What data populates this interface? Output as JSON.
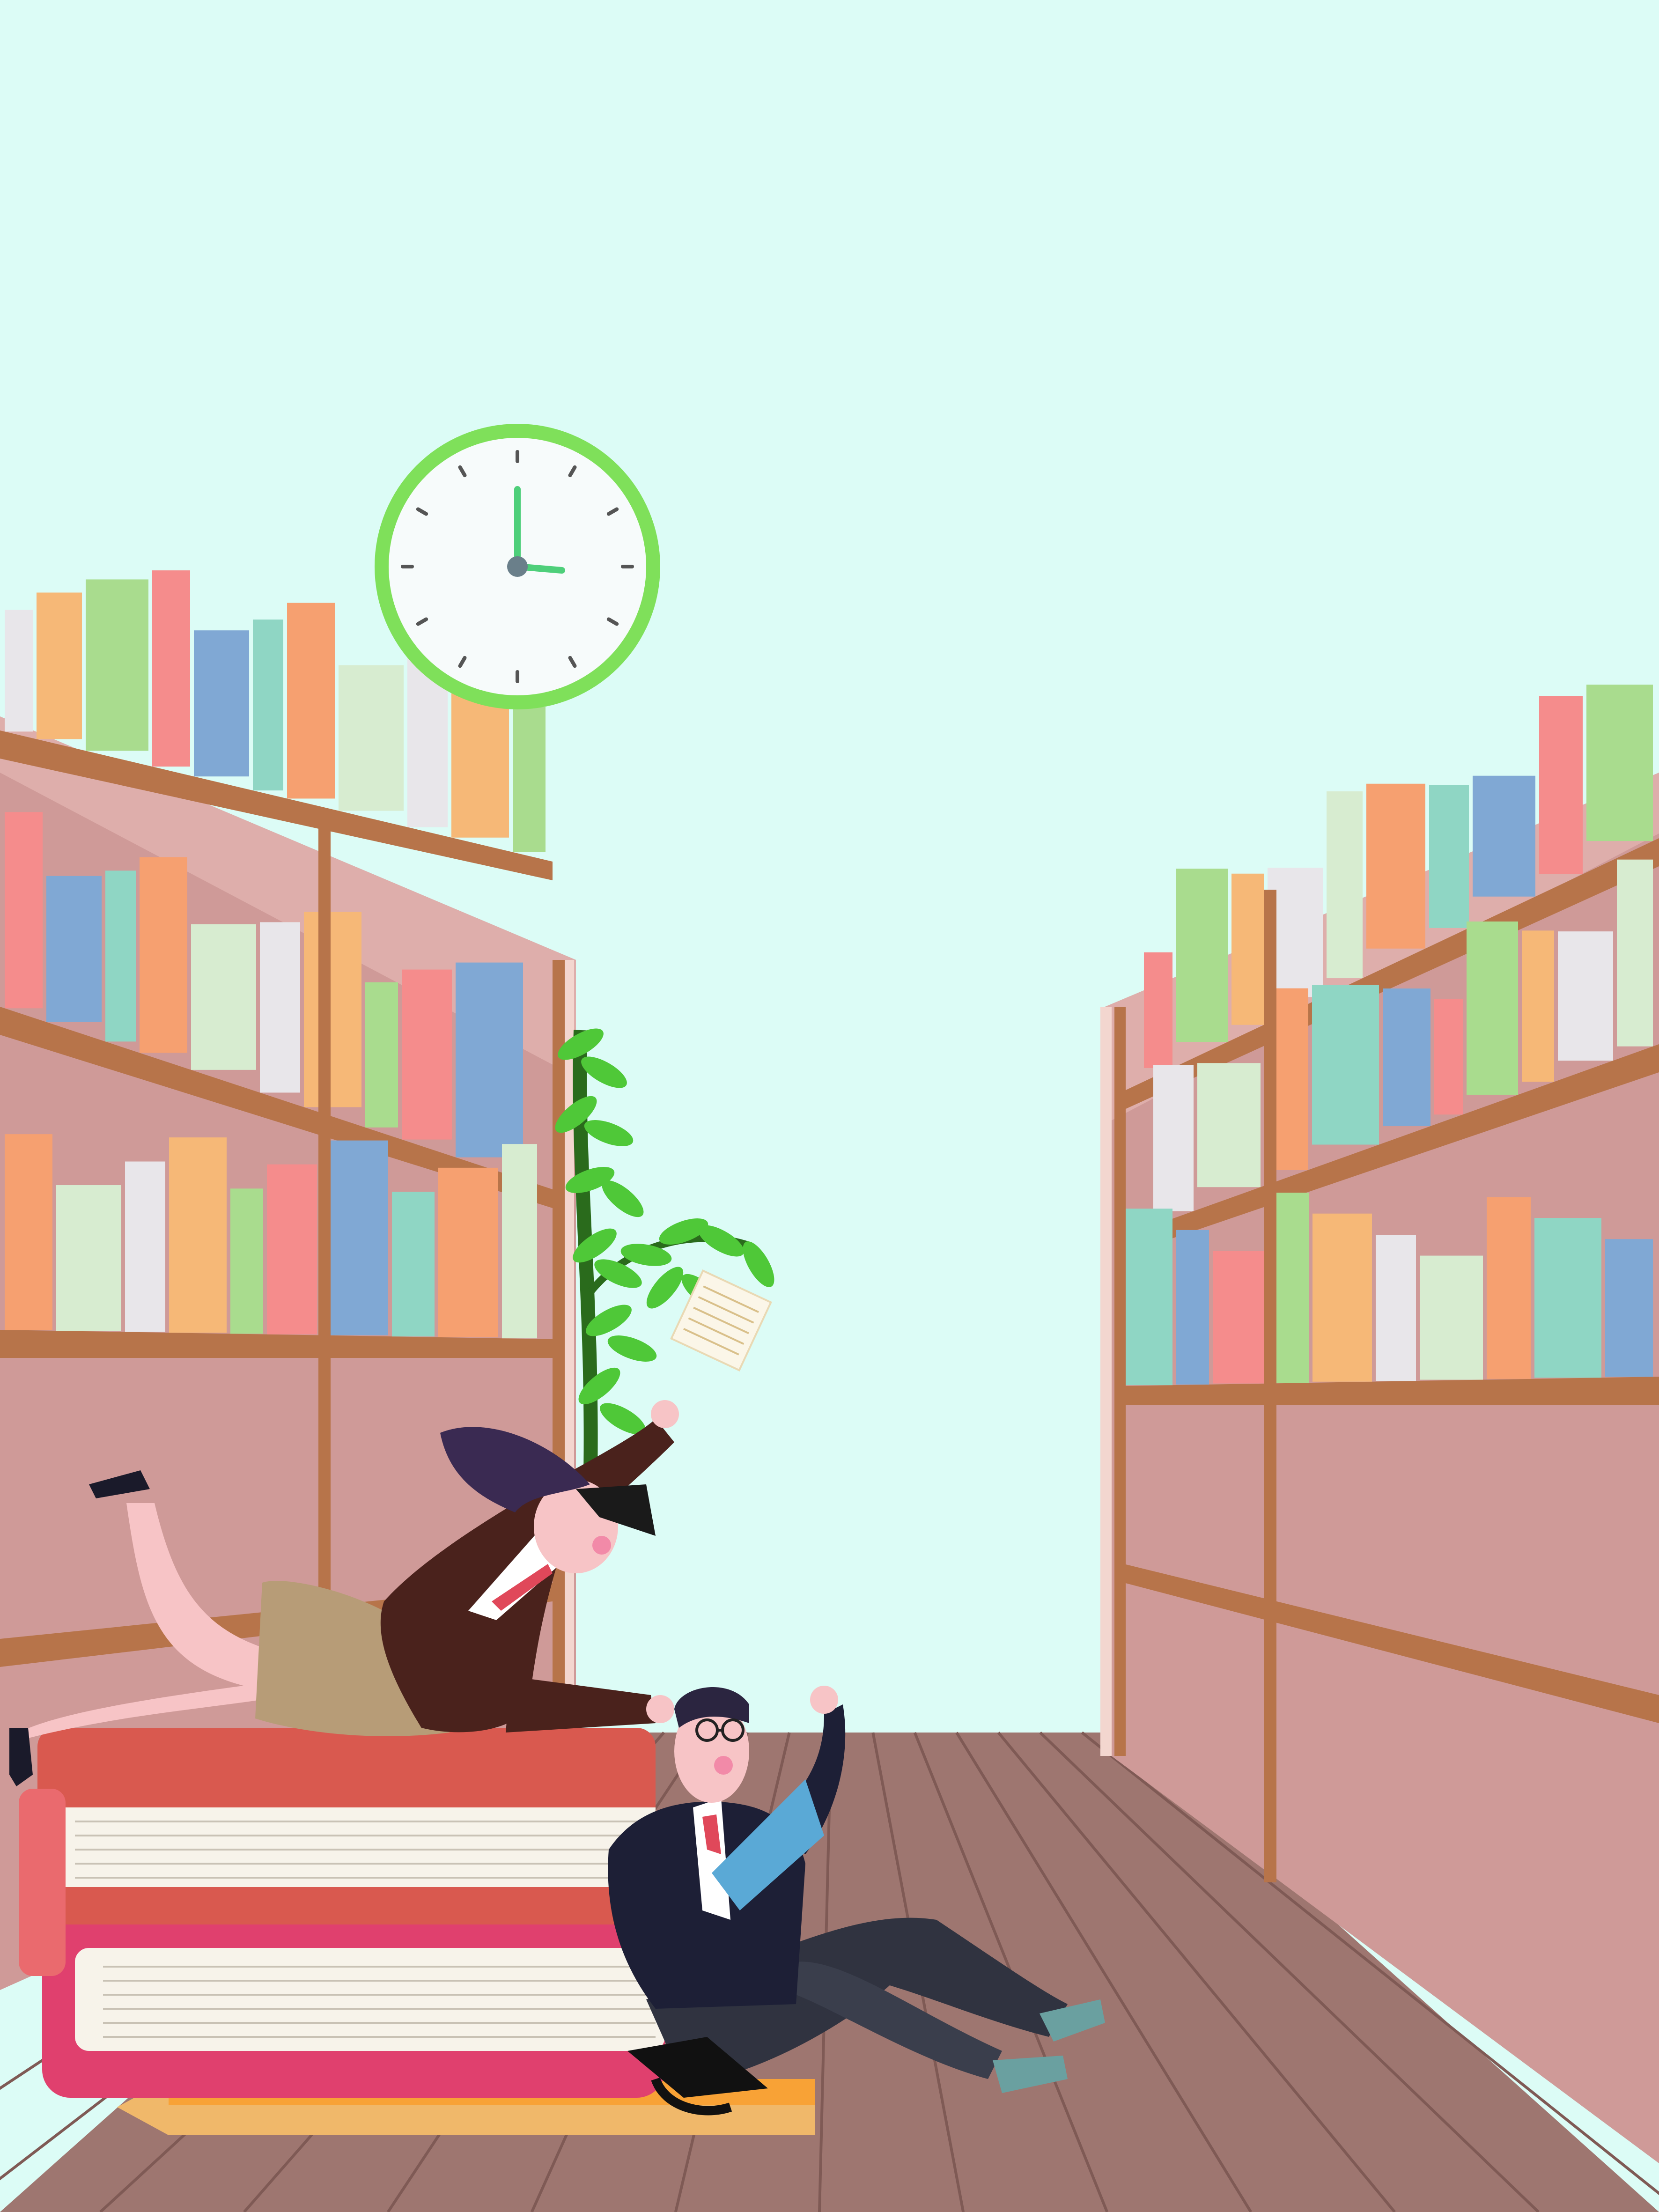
{
  "scene": {
    "sky_color": "#dcfcf6",
    "floor_color": "#9e7670",
    "floor_line_color": "#7f5a55",
    "shelf_wood_color": "#b7744a",
    "shelf_back_color": "#cf9a98",
    "shelf_side_color": "#e8bcb8"
  },
  "clock": {
    "ring_color": "#7fe05a",
    "face_color": "#f7fbfb",
    "hand_color": "#4ecf7a",
    "time_shown": "3:00",
    "icon": "wall-clock-icon"
  },
  "book_colors": [
    "#e8e6ea",
    "#f6b877",
    "#a9dc8e",
    "#f58c8c",
    "#80a8d4",
    "#8fd6c4",
    "#f6a070",
    "#d7ecd0"
  ],
  "figures": {
    "woman": {
      "jacket_color": "#4a221c",
      "skirt_color": "#b79c77",
      "icon": "student-woman-figure"
    },
    "man": {
      "jacket_color": "#1d1f36",
      "trousers_color": "#303340",
      "book_color": "#5aa9d6",
      "icon": "student-man-figure"
    }
  },
  "big_books": {
    "top_color": "#d9594f",
    "middle_color": "#e0406e",
    "pencil_color": "#f8a236"
  },
  "plant": {
    "leaf_color": "#4fc838",
    "stem_color": "#2a6b1c"
  }
}
